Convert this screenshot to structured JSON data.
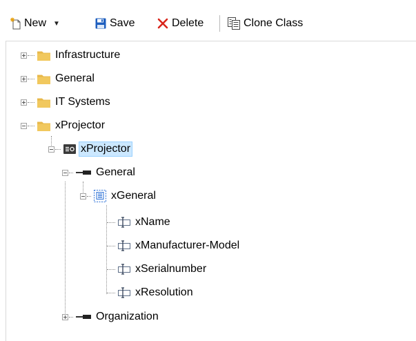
{
  "toolbar": {
    "new_label": "New",
    "save_label": "Save",
    "delete_label": "Delete",
    "clone_label": "Clone Class"
  },
  "tree": {
    "infrastructure": "Infrastructure",
    "general": "General",
    "it_systems": "IT Systems",
    "xprojector_folder": "xProjector",
    "xprojector_class": "xProjector",
    "general_group": "General",
    "xgeneral": "xGeneral",
    "xname": "xName",
    "xmanufacturer_model": "xManufacturer-Model",
    "xserialnumber": "xSerialnumber",
    "xresolution": "xResolution",
    "organization": "Organization"
  },
  "colors": {
    "folder": "#e8b84a",
    "selection": "#cce8ff",
    "save_icon": "#1f5fbf",
    "delete_icon": "#d9261c"
  },
  "icons": {
    "new": "new-icon",
    "save": "save-icon",
    "delete": "delete-icon",
    "clone": "clone-icon",
    "folder": "folder-icon",
    "class": "class-icon",
    "group": "group-icon",
    "form": "form-icon",
    "attribute": "attribute-icon"
  }
}
